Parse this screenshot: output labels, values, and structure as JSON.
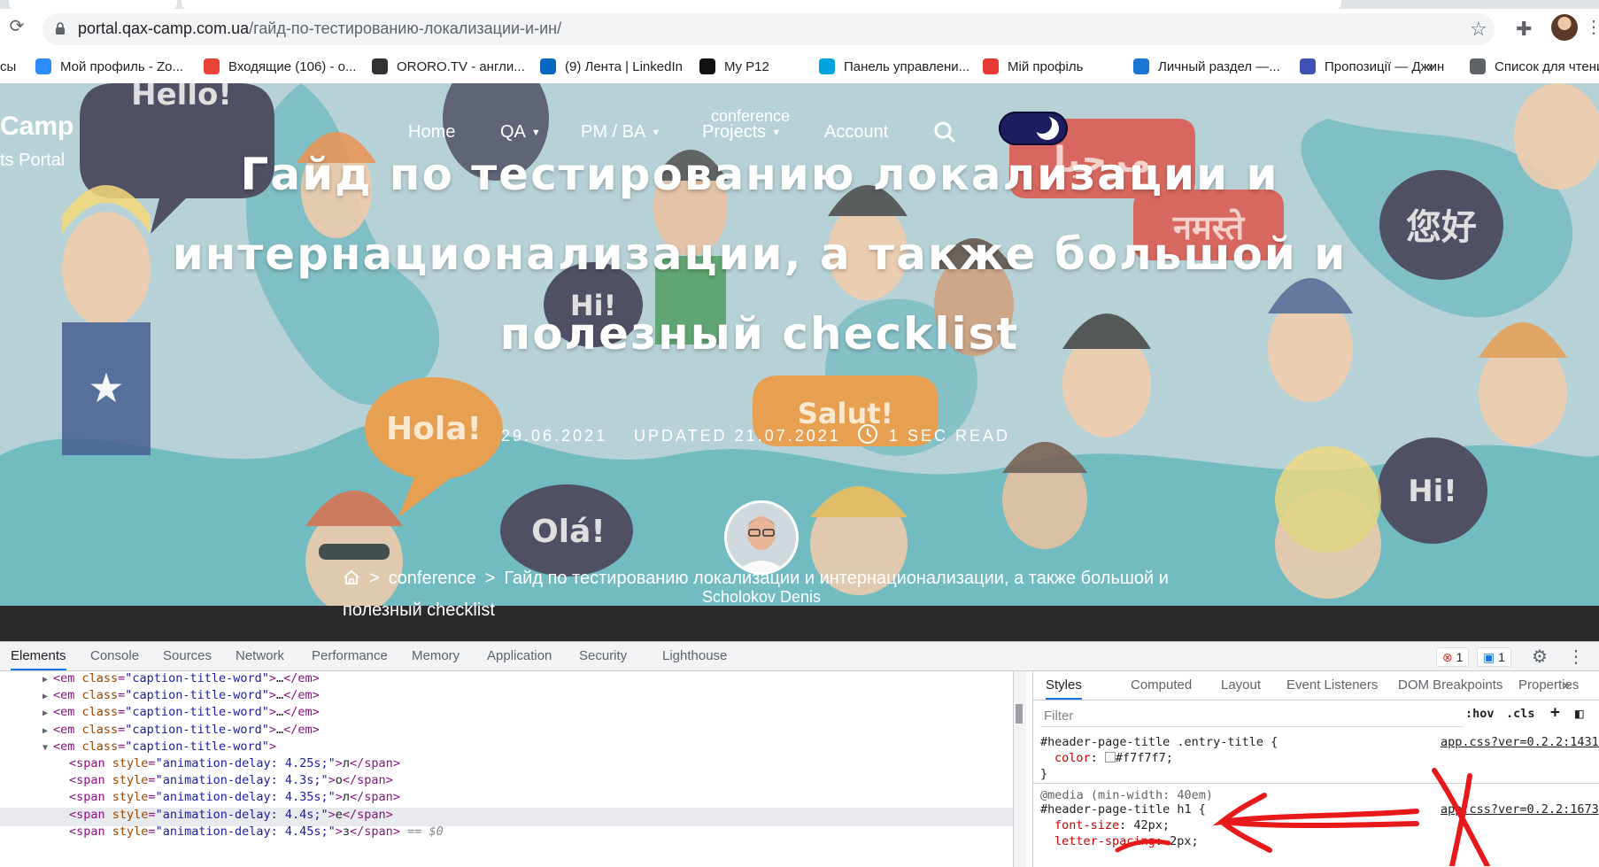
{
  "browser": {
    "url_host": "portal.qax-camp.com.ua",
    "url_path": "/гайд-по-тестированию-локализации-и-ин/",
    "bookmarks": [
      {
        "label": "сы",
        "icon": "none"
      },
      {
        "label": "Мой профиль - Zo...",
        "icon": "zoom-icon",
        "color": "#2d8cff"
      },
      {
        "label": "Входящие (106) - о...",
        "icon": "gmail-icon",
        "color": "#ea4335"
      },
      {
        "label": "ORORO.TV - англи...",
        "icon": "ororo-icon",
        "color": "#333333"
      },
      {
        "label": "(9) Лента | LinkedIn",
        "icon": "linkedin-icon",
        "color": "#0a66c2"
      },
      {
        "label": "My P12",
        "icon": "p12-icon",
        "color": "#111111"
      },
      {
        "label": "Панель управлени...",
        "icon": "panel-icon",
        "color": "#00a3e0"
      },
      {
        "label": "Мій профіль",
        "icon": "profile-icon",
        "color": "#e53935"
      },
      {
        "label": "Личный раздел —...",
        "icon": "personal-icon",
        "color": "#1976d2"
      },
      {
        "label": "Пропозиції — Джин",
        "icon": "djinni-icon",
        "color": "#3f51b5"
      },
      {
        "label": "»",
        "icon": "none"
      },
      {
        "label": "Список для чтени",
        "icon": "reading-list-icon",
        "color": "#5f6368"
      }
    ]
  },
  "site": {
    "logo": "Camp",
    "logo_sub": "ts Portal",
    "nav": [
      {
        "label": "Home",
        "dropdown": false
      },
      {
        "label": "QA",
        "dropdown": true
      },
      {
        "label": "PM / BA",
        "dropdown": true
      },
      {
        "label": "Projects",
        "dropdown": true
      },
      {
        "label": "Account",
        "dropdown": false
      }
    ],
    "nav_overlay": "conference",
    "title": "Гайд по тестированию локализации и интернационализации, а также большой и полезный checklist",
    "meta": {
      "date": "29.06.2021",
      "updated": "UPDATED 21.07.2021",
      "read_time": "1 SEC READ"
    },
    "author": "Scholokov Denis",
    "breadcrumb": {
      "category": "conference",
      "current_line1": "Гайд по тестированию локализации и интернационализации, а также большой и",
      "current_line2": "полезный checklist"
    },
    "bubbles": [
      "Hello!",
      "Hola!",
      "Olá!",
      "Salut!",
      "Hi!",
      "Hi!",
      "您好",
      "नमस्ते",
      "مرحبا"
    ]
  },
  "devtools": {
    "tabs": [
      "Elements",
      "Console",
      "Sources",
      "Network",
      "Performance",
      "Memory",
      "Application",
      "Security",
      "Lighthouse"
    ],
    "active_tab": "Elements",
    "errors": "1",
    "messages": "1",
    "tree": [
      {
        "collapsed": true,
        "tag": "em",
        "attr": "class",
        "val": "caption-title-word",
        "text": "…"
      },
      {
        "collapsed": true,
        "tag": "em",
        "attr": "class",
        "val": "caption-title-word",
        "text": "…"
      },
      {
        "collapsed": true,
        "tag": "em",
        "attr": "class",
        "val": "caption-title-word",
        "text": "…"
      },
      {
        "collapsed": true,
        "tag": "em",
        "attr": "class",
        "val": "caption-title-word",
        "text": "…"
      },
      {
        "collapsed": false,
        "tag": "em",
        "attr": "class",
        "val": "caption-title-word",
        "text": ""
      },
      {
        "tag": "span",
        "attr": "style",
        "val": "animation-delay: 4.25s;",
        "text": "л"
      },
      {
        "tag": "span",
        "attr": "style",
        "val": "animation-delay: 4.3s;",
        "text": "о"
      },
      {
        "tag": "span",
        "attr": "style",
        "val": "animation-delay: 4.35s;",
        "text": "л"
      },
      {
        "tag": "span",
        "attr": "style",
        "val": "animation-delay: 4.4s;",
        "text": "е"
      },
      {
        "tag": "span",
        "attr": "style",
        "val": "animation-delay: 4.45s;",
        "text": "з",
        "selected": true,
        "marker": "== $0"
      }
    ],
    "styles_tabs": [
      "Styles",
      "Computed",
      "Layout",
      "Event Listeners",
      "DOM Breakpoints",
      "Properties",
      "»"
    ],
    "filter_placeholder": "Filter",
    "hov": ":hov",
    "cls": ".cls",
    "plus": "+",
    "rules": [
      {
        "selector": "#header-page-title .entry-title {",
        "source": "app.css?ver=0.2.2:1431",
        "prop": "color",
        "value": "#f7f7f7;"
      },
      {
        "media": "@media (min-width: 40em)",
        "selector": "#header-page-title h1 {",
        "source": "app.css?ver=0.2.2:1673",
        "prop": "font-size",
        "value": "42px;",
        "prop2": "letter-spacing",
        "value2": "2px;"
      }
    ]
  }
}
